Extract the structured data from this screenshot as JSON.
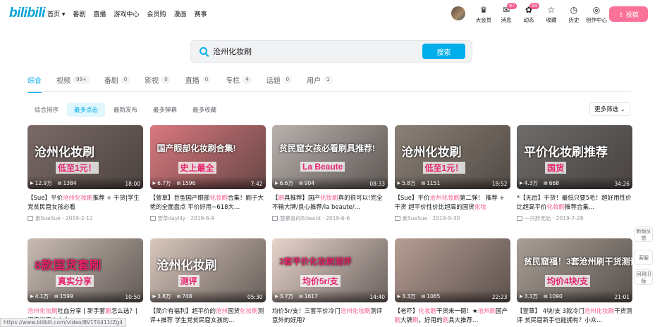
{
  "logo": "bilibili",
  "nav": [
    "首页 ▾",
    "番剧",
    "直播",
    "游戏中心",
    "会员购",
    "漫画",
    "赛事"
  ],
  "header_icons": [
    {
      "icon": "crown-icon",
      "glyph": "♛",
      "label": "大会员",
      "badge": ""
    },
    {
      "icon": "message-icon",
      "glyph": "✉",
      "label": "消息",
      "badge": "87"
    },
    {
      "icon": "wind-icon",
      "glyph": "✿",
      "label": "动态",
      "badge": "99"
    },
    {
      "icon": "star-icon",
      "glyph": "☆",
      "label": "收藏",
      "badge": ""
    },
    {
      "icon": "history-icon",
      "glyph": "◷",
      "label": "历史",
      "badge": ""
    },
    {
      "icon": "bulb-icon",
      "glyph": "◎",
      "label": "创作中心",
      "badge": ""
    }
  ],
  "upload_label": "⇪ 投稿",
  "search": {
    "query": "沧州化妆刷",
    "button": "搜索"
  },
  "tabs": [
    {
      "label": "综合",
      "count": ""
    },
    {
      "label": "视频",
      "count": "99+"
    },
    {
      "label": "番剧",
      "count": "0"
    },
    {
      "label": "影视",
      "count": "0"
    },
    {
      "label": "直播",
      "count": "0"
    },
    {
      "label": "专栏",
      "count": "4"
    },
    {
      "label": "话题",
      "count": "0"
    },
    {
      "label": "用户",
      "count": "1"
    }
  ],
  "sorts": [
    "综合排序",
    "最多点击",
    "最新发布",
    "最多弹幕",
    "最多收藏"
  ],
  "filter_label": "更多筛选 ⌄",
  "videos": [
    {
      "thumb_text": "沧州化妆刷",
      "thumb_sub": "低至1元！",
      "bg": "#7a6a66",
      "fg": "#ffffff",
      "views": "12.9万",
      "danmaku": "1384",
      "duration": "18:00",
      "title_parts": [
        [
          "【Sue】平价",
          0
        ],
        [
          "沧州化妆刷",
          1
        ],
        [
          "推荐 + 干货|学生党贫民窟女孩必看",
          0
        ]
      ],
      "uploader": "素SueSue",
      "date": "2019-2-12"
    },
    {
      "thumb_text": "国产眼部化妆刷合集!",
      "thumb_sub": "史上最全",
      "bg": "#d9787e",
      "fg": "#ffffff",
      "views": "6.7万",
      "danmaku": "1596",
      "duration": "7:42",
      "title_parts": [
        [
          "【萱草】巨型国产眼部",
          0
        ],
        [
          "化妆刷",
          1
        ],
        [
          "合集！刷子大佬的全面盘点 平价好用~618大...",
          0
        ]
      ],
      "uploader": "萱草daylily",
      "date": "2019-6-9"
    },
    {
      "thumb_text": "贫民窟女孩必看刷具推荐!",
      "thumb_sub": "La Beaute",
      "bg": "#b8b1ad",
      "fg": "#ffffff",
      "views": "6.6万",
      "danmaku": "904",
      "duration": "08:33",
      "title_parts": [
        [
          "【",
          0
        ],
        [
          "刷",
          1
        ],
        [
          "具推荐】国产",
          0
        ],
        [
          "化妆刷",
          1
        ],
        [
          "真的很可以!完全不输大牌/良心推荐/la beaute/...",
          0
        ]
      ],
      "uploader": "慧慕喜的Edward",
      "date": "2019-6-6"
    },
    {
      "thumb_text": "沧州化妆刷",
      "thumb_sub": "低至1元！",
      "bg": "#8a8176",
      "fg": "#ffffff",
      "views": "5.8万",
      "danmaku": "1151",
      "duration": "18:52",
      "title_parts": [
        [
          "【Sue】平价",
          0
        ],
        [
          "沧州化妆刷",
          1
        ],
        [
          "第二弹！ 推荐 + 干货 超平价性价比超高的国货",
          0
        ],
        [
          "化妆",
          1
        ]
      ],
      "uploader": "素SueSue",
      "date": "2019-9-30"
    },
    {
      "thumb_text": "平价化妆刷推荐",
      "thumb_sub": "国货",
      "bg": "#6e6b69",
      "fg": "#ffffff",
      "views": "4.3万",
      "danmaku": "668",
      "duration": "34:26",
      "title_parts": [
        [
          "*【无后】干货！最低只要5毛！超好用性价比超高平价",
          0
        ],
        [
          "化妆刷",
          1
        ],
        [
          "推荐合集...",
          0
        ]
      ],
      "uploader": "一只胖无后",
      "date": "2019-7-28"
    },
    {
      "thumb_text": "8款国货套刷",
      "thumb_sub": "真实分享",
      "bg": "#c9bcb3",
      "fg": "#e6246b",
      "views": "4.1万",
      "danmaku": "1599",
      "duration": "10:50",
      "title_parts": [
        [
          "沧州化妆刷",
          1
        ],
        [
          "吐血分享 | 新手套",
          0
        ],
        [
          "刷",
          1
        ],
        [
          "怎么选？| 避雷指南 | 小众...",
          0
        ]
      ],
      "uploader": "",
      "date": ""
    },
    {
      "thumb_text": "沧州化妆刷",
      "thumb_sub": "测评",
      "bg": "#d8c7bd",
      "fg": "#ffffff",
      "views": "3.8万",
      "danmaku": "748",
      "duration": "05:30",
      "title_parts": [
        [
          "【简介有福利】超平价的",
          0
        ],
        [
          "沧州",
          1
        ],
        [
          "国货",
          0
        ],
        [
          "化妆刷",
          1
        ],
        [
          "测评+推荐 学生党贫民窟女孩的...",
          0
        ]
      ],
      "uploader": "",
      "date": ""
    },
    {
      "thumb_text": "3套平价化妆刷测评",
      "thumb_sub": "均价5r/支",
      "bg": "#e7d4cc",
      "fg": "#e6246b",
      "views": "3.7万",
      "danmaku": "1617",
      "duration": "14:40",
      "title_parts": [
        [
          "均价5r/支！三套平价冷门",
          0
        ],
        [
          "沧州化妆刷",
          1
        ],
        [
          "测评 意外的好用?",
          0
        ]
      ],
      "uploader": "",
      "date": ""
    },
    {
      "thumb_text": "",
      "thumb_sub": "",
      "bg": "#b59d94",
      "fg": "#ffffff",
      "views": "3.3万",
      "danmaku": "1065",
      "duration": "22:23",
      "title_parts": [
        [
          "【老吓】",
          0
        ],
        [
          "化妆刷",
          1
        ],
        [
          "干货来一碗！★",
          0
        ],
        [
          "沧州刷",
          1
        ],
        [
          "国产",
          0
        ],
        [
          "刷",
          1
        ],
        [
          "大牌",
          0
        ],
        [
          "刷",
          1
        ],
        [
          "，好用的",
          0
        ],
        [
          "刷",
          1
        ],
        [
          "具大推荐...",
          0
        ]
      ],
      "uploader": "",
      "date": ""
    },
    {
      "thumb_text": "贫民窟福！3套沧州刷干货测评",
      "thumb_sub": "均价4块/支",
      "bg": "#a89e95",
      "fg": "#ffffff",
      "views": "3.1万",
      "danmaku": "1090",
      "duration": "21:01",
      "title_parts": [
        [
          "【萱草】 4块/支 3款冷门",
          0
        ],
        [
          "沧州化妆刷",
          1
        ],
        [
          "干货测评 贫民窟新手也能拥有？小众...",
          0
        ]
      ],
      "uploader": "",
      "date": ""
    }
  ],
  "side_float": [
    "新版反馈",
    "客服",
    "回到旧版"
  ],
  "status_url": "https://www.bilibili.com/video/BV1T4411tZg4"
}
